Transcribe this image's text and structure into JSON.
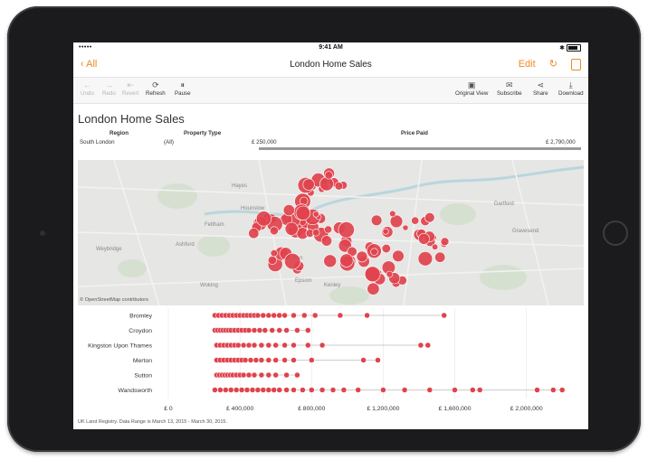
{
  "status": {
    "carrier": "•••••",
    "time": "9:41 AM",
    "battery_pct": "100%"
  },
  "nav": {
    "back": "All",
    "title": "London Home Sales",
    "edit": "Edit"
  },
  "toolbar": {
    "left": [
      {
        "label": "Undo",
        "icon": "undo-icon",
        "glyph": "←",
        "enabled": false
      },
      {
        "label": "Redo",
        "icon": "redo-icon",
        "glyph": "→",
        "enabled": false
      },
      {
        "label": "Revert",
        "icon": "revert-icon",
        "glyph": "⇤",
        "enabled": false
      },
      {
        "label": "Refresh",
        "icon": "refresh-icon",
        "glyph": "⟳",
        "enabled": true
      },
      {
        "label": "Pause",
        "icon": "pause-icon",
        "glyph": "⏸",
        "enabled": true
      }
    ],
    "right": [
      {
        "label": "Original View",
        "icon": "original-view-icon",
        "glyph": "▣"
      },
      {
        "label": "Subscribe",
        "icon": "subscribe-icon",
        "glyph": "✉"
      },
      {
        "label": "Share",
        "icon": "share-icon",
        "glyph": "⋖"
      },
      {
        "label": "Download",
        "icon": "download-icon",
        "glyph": "⤓"
      }
    ]
  },
  "dashboard": {
    "title": "London Home Sales"
  },
  "filters": {
    "region": {
      "label": "Region",
      "value": "South London",
      "all": "(All)"
    },
    "property": {
      "label": "Property Type"
    },
    "price": {
      "label": "Price Paid",
      "min": "£ 250,000",
      "max": "£ 2,790,000"
    }
  },
  "map": {
    "attribution": "© OpenStreetMap contributors",
    "place_labels": [
      "Hayes",
      "Hounslow",
      "Feltham",
      "Ashford",
      "Walton",
      "Weybridge",
      "Woking",
      "Epsom",
      "Kenley",
      "Dartford",
      "Gravesend"
    ],
    "colors": {
      "land": "#e6e6e4",
      "water": "#b9d6dd",
      "park": "#d5e0d1",
      "point": "#e0434d",
      "point_stroke": "#ffffff"
    }
  },
  "chart_data": {
    "type": "scatter",
    "title": "",
    "categories": [
      "Bromley",
      "Croydon",
      "Kingston Upon Thames",
      "Merton",
      "Sutton",
      "Wandsworth"
    ],
    "x_ticks": [
      "£ 0",
      "£ 400,000",
      "£ 800,000",
      "£ 1,200,000",
      "£ 1,600,000",
      "£ 2,000,000"
    ],
    "xlim": [
      0,
      2300000
    ],
    "series": [
      {
        "category": "Bromley",
        "values": [
          260000,
          280000,
          300000,
          320000,
          340000,
          360000,
          380000,
          400000,
          420000,
          440000,
          460000,
          480000,
          500000,
          530000,
          560000,
          590000,
          620000,
          650000,
          700000,
          760000,
          820000,
          960000,
          1110000,
          1540000
        ]
      },
      {
        "category": "Croydon",
        "values": [
          260000,
          275000,
          290000,
          305000,
          320000,
          335000,
          350000,
          370000,
          390000,
          410000,
          430000,
          450000,
          480000,
          510000,
          540000,
          580000,
          620000,
          660000,
          720000,
          780000
        ]
      },
      {
        "category": "Kingston Upon Thames",
        "values": [
          270000,
          290000,
          310000,
          330000,
          350000,
          370000,
          390000,
          420000,
          450000,
          480000,
          520000,
          560000,
          600000,
          650000,
          700000,
          780000,
          860000,
          1410000,
          1450000
        ]
      },
      {
        "category": "Merton",
        "values": [
          270000,
          290000,
          310000,
          330000,
          350000,
          370000,
          390000,
          410000,
          430000,
          460000,
          490000,
          520000,
          560000,
          600000,
          650000,
          700000,
          800000,
          1090000,
          1170000
        ]
      },
      {
        "category": "Sutton",
        "values": [
          270000,
          285000,
          300000,
          315000,
          330000,
          345000,
          360000,
          380000,
          400000,
          420000,
          450000,
          480000,
          520000,
          560000,
          600000,
          660000,
          720000
        ]
      },
      {
        "category": "Wandsworth",
        "values": [
          260000,
          290000,
          320000,
          350000,
          380000,
          410000,
          440000,
          470000,
          500000,
          530000,
          560000,
          590000,
          620000,
          660000,
          700000,
          750000,
          800000,
          860000,
          920000,
          980000,
          1060000,
          1200000,
          1320000,
          1460000,
          1600000,
          1700000,
          1740000,
          2060000,
          2150000,
          2200000
        ]
      }
    ],
    "grid": true,
    "legend": "none",
    "point_color": "#e0434d"
  },
  "source_note": "UK Land Registry. Data Range is March 13, 2015 - March 30, 2015."
}
